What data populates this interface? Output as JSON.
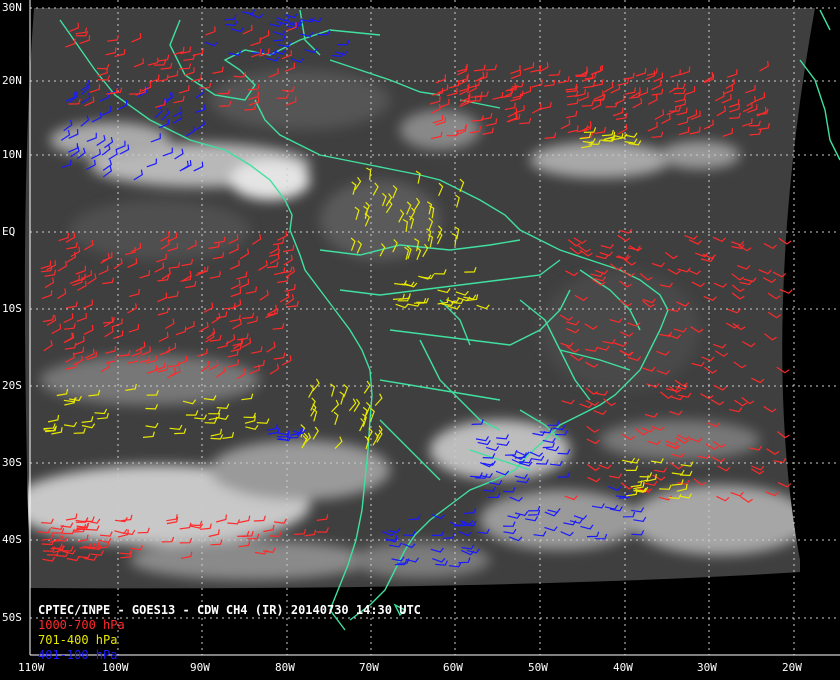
{
  "title": "CPTEC/INPE - GOES13 - CDW CH4 (IR) 20140730 14:30 UTC",
  "legend": [
    {
      "label": "1000-700 hPa",
      "color": "#ff2a2a"
    },
    {
      "label": "701-400 hPa",
      "color": "#e8e800"
    },
    {
      "label": "401-100 hPa",
      "color": "#1a1aff"
    }
  ],
  "lat_labels": [
    "30N",
    "20N",
    "10N",
    "EQ",
    "10S",
    "20S",
    "30S",
    "40S",
    "50S"
  ],
  "lon_labels": [
    "110W",
    "100W",
    "90W",
    "80W",
    "70W",
    "60W",
    "50W",
    "40W",
    "30W",
    "20W"
  ],
  "colors": {
    "coastline": "#40e0a0",
    "grid": "#cccccc",
    "background": "#000000"
  }
}
